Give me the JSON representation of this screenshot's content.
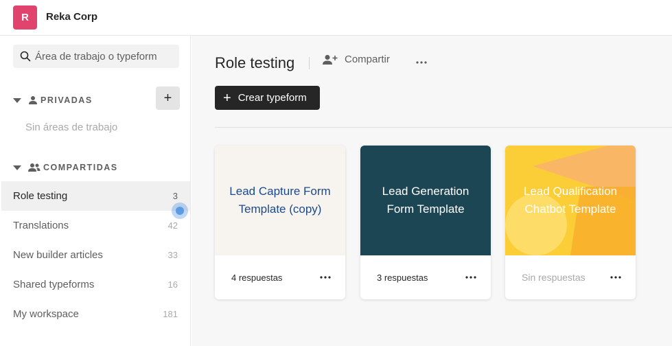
{
  "org": {
    "initial": "R",
    "name": "Reka Corp"
  },
  "sidebar": {
    "search_placeholder": "Área de trabajo o typeform",
    "private_section": {
      "label": "PRIVADAS",
      "add_label": "+",
      "empty_text": "Sin áreas de trabajo"
    },
    "shared_section": {
      "label": "COMPARTIDAS"
    },
    "workspaces": [
      {
        "name": "Role testing",
        "count": "3"
      },
      {
        "name": "Translations",
        "count": "42"
      },
      {
        "name": "New builder articles",
        "count": "33"
      },
      {
        "name": "Shared typeforms",
        "count": "16"
      },
      {
        "name": "My workspace",
        "count": "181"
      }
    ]
  },
  "main": {
    "title": "Role testing",
    "share_label": "Compartir",
    "create_label": "Crear typeform",
    "create_plus": "+",
    "forms": [
      {
        "title": "Lead Capture Form Template (copy)",
        "responses": "4 respuestas"
      },
      {
        "title": "Lead Generation Form Template",
        "responses": "3 respuestas"
      },
      {
        "title": "Lead Qualification Chatbot Template",
        "responses": "Sin respuestas"
      }
    ]
  },
  "colors": {
    "avatar": "#e0436e",
    "card1_bg": "#f7f3ee",
    "card1_text": "#1c4a8c",
    "card2_bg": "#1d4654",
    "card3_bg": "#fbcd37",
    "create_button": "#262627"
  },
  "icons": [
    "search-icon",
    "caret-down-icon",
    "user-icon",
    "users-icon",
    "add-user-icon",
    "more-horizontal-icon",
    "plus-icon"
  ]
}
